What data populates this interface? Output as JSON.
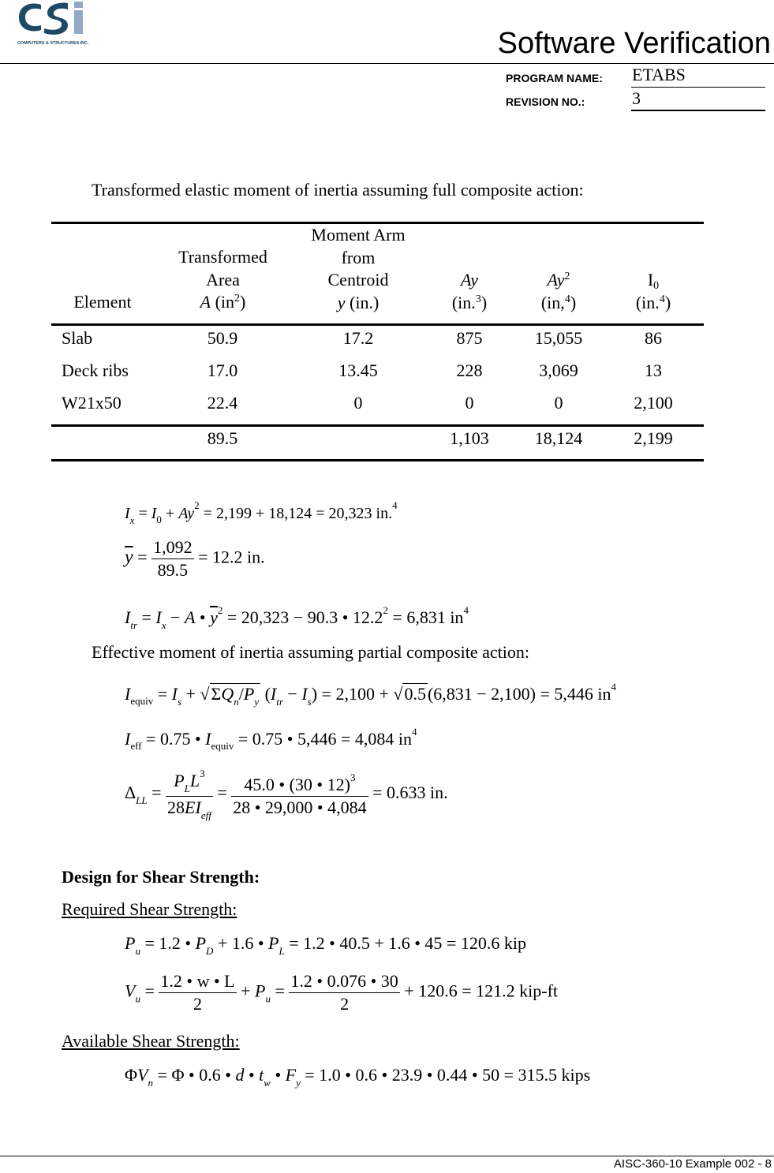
{
  "header": {
    "logo_text": "CSi",
    "logo_tagline": "COMPUTERS & STRUCTURES INC.",
    "title": "Software Verification",
    "program_name_label": "PROGRAM NAME:",
    "program_name_value": "ETABS",
    "revision_label": "REVISION NO.:",
    "revision_value": "3",
    "brand_colors": {
      "dark": "#1e4a66",
      "light": "#8fa9c6"
    }
  },
  "intro": "Transformed elastic moment of inertia assuming full composite action:",
  "table": {
    "headers": [
      {
        "lines": [
          "Element"
        ]
      },
      {
        "lines": [
          "Transformed",
          "Area"
        ],
        "unit_var": "A",
        "unit": "(in",
        "unit_sup": "2",
        "unit_end": ")"
      },
      {
        "lines": [
          "Moment Arm",
          "from",
          "Centroid"
        ],
        "unit_var": "y",
        "unit": " (in.)",
        "unit_sup": "",
        "unit_end": ""
      },
      {
        "var": "Ay",
        "unit": "(in.",
        "unit_sup": "3",
        "unit_end": ")"
      },
      {
        "var": "Ay",
        "var_sup": "2",
        "unit": "(in,",
        "unit_sup": "4",
        "unit_end": ")"
      },
      {
        "var": "I",
        "var_sub": "0",
        "unit": "(in.",
        "unit_sup": "4",
        "unit_end": ")"
      }
    ],
    "rows": [
      [
        "Slab",
        "50.9",
        "17.2",
        "875",
        "15,055",
        "86"
      ],
      [
        "Deck ribs",
        "17.0",
        "13.45",
        "228",
        "3,069",
        "13"
      ],
      [
        "W21x50",
        "22.4",
        "0",
        "0",
        "0",
        "2,100"
      ]
    ],
    "totals": [
      "",
      "89.5",
      "",
      "1,103",
      "18,124",
      "2,199"
    ]
  },
  "equations": {
    "ix": {
      "rhs": "= 2,199 + 18,124 = 20,323 in.",
      "exp": "4"
    },
    "ybar": {
      "num": "1,092",
      "den": "89.5",
      "result": "= 12.2 in."
    },
    "itr": {
      "rhs": "= 20,323 − 90.3 • 12.2",
      "exp1": "2",
      "result": " = 6,831 in",
      "exp2": "4"
    },
    "partial_heading": "Effective moment of inertia assuming partial composite action:",
    "iequiv": {
      "rhs1": "= 2,100 + ",
      "sqrt_val": "0.5",
      "rhs2": "(6,831 − 2,100) = 5,446 in",
      "exp": "4"
    },
    "ieff": {
      "rhs": "= 0.75 • ",
      "rhs2": " = 0.75 • 5,446 = 4,084 in",
      "exp": "4"
    },
    "delta": {
      "num_val": "45.0 • (30 • 12)",
      "num_exp": "3",
      "den_val": "28 • 29,000 • 4,084",
      "result": "= 0.633 in."
    }
  },
  "shear": {
    "heading": "Design for Shear Strength:",
    "required_heading": "Required Shear Strength:",
    "pu": {
      "rhs": "= 1.2 • 40.5 + 1.6 • 45 = 120.6 kip"
    },
    "vu": {
      "num1": "1.2 • w • L",
      "den1": "2",
      "num2": "1.2 • 0.076 • 30",
      "den2": "2",
      "result": "+ 120.6 = 121.2 kip-ft"
    },
    "available_heading": "Available Shear Strength:",
    "phivn": {
      "rhs": "= 1.0 • 0.6 • 23.9 • 0.44 • 50 = 315.5 kips"
    }
  },
  "footer": "AISC-360-10 Example 002 - 8"
}
